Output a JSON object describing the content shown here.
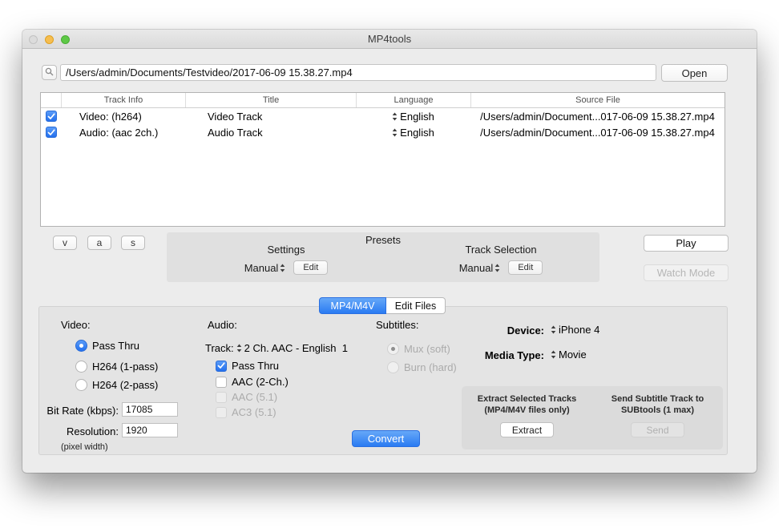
{
  "window": {
    "title": "MP4tools"
  },
  "toolbar": {
    "path_value": "/Users/admin/Documents/Testvideo/2017-06-09 15.38.27.mp4",
    "open_label": "Open"
  },
  "track_table": {
    "columns": [
      "Track Info",
      "Title",
      "Language",
      "Source File"
    ],
    "rows": [
      {
        "checked": true,
        "track_info": "Video: (h264)",
        "title": "Video Track",
        "language": "English",
        "source_file": "/Users/admin/Document...017-06-09 15.38.27.mp4"
      },
      {
        "checked": true,
        "track_info": "Audio: (aac 2ch.)",
        "title": "Audio Track",
        "language": "English",
        "source_file": "/Users/admin/Document...017-06-09 15.38.27.mp4"
      }
    ]
  },
  "track_type_buttons": {
    "video": "v",
    "audio": "a",
    "subtitles": "s"
  },
  "presets": {
    "title": "Presets",
    "settings": {
      "label": "Settings",
      "value": "Manual",
      "edit_label": "Edit"
    },
    "track_selection": {
      "label": "Track Selection",
      "value": "Manual",
      "edit_label": "Edit"
    }
  },
  "playback": {
    "play_label": "Play",
    "watch_mode_label": "Watch Mode"
  },
  "tabs": {
    "mp4": "MP4/M4V",
    "edit_files": "Edit Files"
  },
  "video": {
    "heading": "Video:",
    "pass_thru": "Pass Thru",
    "h264_1pass": "H264 (1-pass)",
    "h264_2pass": "H264 (2-pass)",
    "bit_rate_label": "Bit Rate (kbps):",
    "bit_rate_value": "17085",
    "resolution_label": "Resolution:",
    "resolution_value": "1920",
    "resolution_note": "(pixel width)"
  },
  "audio": {
    "heading": "Audio:",
    "track_label": "Track:",
    "track_value": "2 Ch. AAC - English  1",
    "pass_thru": "Pass Thru",
    "aac_2ch": "AAC (2-Ch.)",
    "aac_51": "AAC (5.1)",
    "ac3_51": "AC3 (5.1)"
  },
  "subtitles": {
    "heading": "Subtitles:",
    "mux": "Mux (soft)",
    "burn": "Burn (hard)"
  },
  "output": {
    "device_label": "Device:",
    "device_value": "iPhone 4",
    "media_type_label": "Media Type:",
    "media_type_value": "Movie",
    "convert_label": "Convert"
  },
  "extract_panel": {
    "extract_title_1": "Extract Selected Tracks",
    "extract_title_2": "(MP4/M4V files only)",
    "extract_button": "Extract",
    "send_title_1": "Send Subtitle Track to",
    "send_title_2": "SUBtools (1 max)",
    "send_button": "Send"
  },
  "colors": {
    "accent_blue": "#2f7cf6",
    "checkbox_blue": "#3b82f7"
  }
}
